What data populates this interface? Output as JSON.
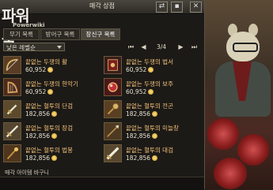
{
  "window": {
    "title": "매각 상점"
  },
  "logo": {
    "text": "파워북",
    "subtext": "Powerwiki"
  },
  "tabs": [
    {
      "label": "무기 목록",
      "active": false
    },
    {
      "label": "방어구 목록",
      "active": false
    },
    {
      "label": "장신구 목록",
      "active": true
    }
  ],
  "filter": {
    "sort_selected": "낮은 레벨순"
  },
  "pager": {
    "page": "3/4"
  },
  "items": [
    {
      "name": "끝없는 두쟁의 활",
      "price": "60,952",
      "icon": "bow-icon"
    },
    {
      "name": "끝없는 두쟁의 법서",
      "price": "60,952",
      "icon": "spellbook-icon"
    },
    {
      "name": "끝없는 두쟁의 현악기",
      "price": "60,952",
      "icon": "harp-icon"
    },
    {
      "name": "끝없는 두쟁의 보주",
      "price": "60,952",
      "icon": "orb-icon"
    },
    {
      "name": "끝없는 혈투의 단검",
      "price": "182,856",
      "icon": "dagger-icon"
    },
    {
      "name": "끝없는 혈투의 전곤",
      "price": "182,856",
      "icon": "mace-icon"
    },
    {
      "name": "끝없는 혈투의 장검",
      "price": "182,856",
      "icon": "longsword-icon"
    },
    {
      "name": "끝없는 혈투의 미늘창",
      "price": "182,856",
      "icon": "polearm-icon"
    },
    {
      "name": "끝없는 혈투의 법봉",
      "price": "182,856",
      "icon": "staff-icon"
    },
    {
      "name": "끝없는 혈투의 대검",
      "price": "182,856",
      "icon": "greatsword-icon"
    }
  ],
  "cart": {
    "label": "매각 아이템 바구니"
  },
  "colors": {
    "item_name": "#f3c17a",
    "price": "#e7e1d0",
    "panel_bg": "#1c1a17"
  }
}
